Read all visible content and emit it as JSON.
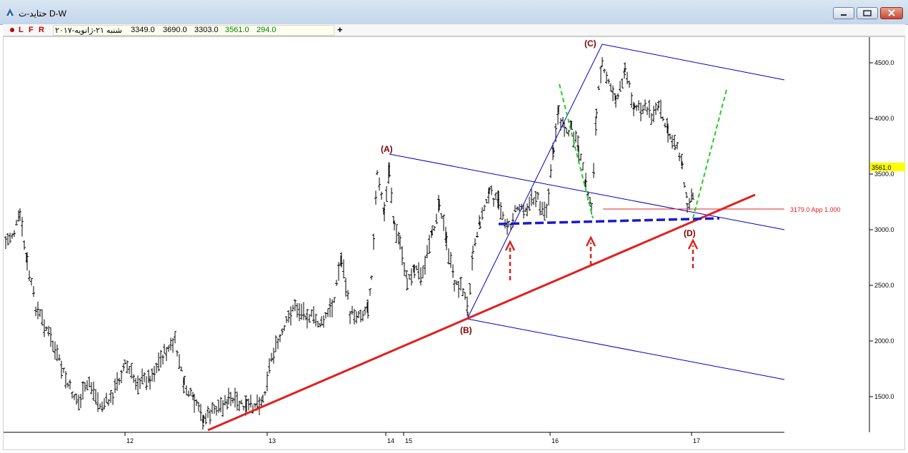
{
  "window": {
    "title": "حتاید-ت D-W",
    "buttons": [
      "minimize",
      "restore",
      "close"
    ]
  },
  "infobar": {
    "letters": [
      "L",
      "F",
      "R"
    ],
    "date": "شنبه ۲۱-ژانویه-۲۰۱۷",
    "open": "3349.0",
    "high": "3690.0",
    "low": "3303.0",
    "close": "3561.0",
    "change": "294.0",
    "add_symbol": "+"
  },
  "chart_data": {
    "type": "candlestick",
    "y_axis": {
      "ticks": [
        1500,
        2000,
        2500,
        3000,
        3500,
        4000,
        4500
      ],
      "tick_labels": [
        "1500.0",
        "2000.0",
        "2500.0",
        "3000.0",
        "3500.0",
        "4000.0",
        "4500.0"
      ]
    },
    "x_axis": {
      "ticks": [
        "12",
        "13",
        "14",
        "15",
        "16",
        "17"
      ]
    },
    "last_price": {
      "value": 3561.0,
      "label": "3561.0",
      "color": "#ffff00"
    },
    "price_line": {
      "value": 3179.0,
      "label": "3179.0 App 1.000",
      "color": "#e02020"
    },
    "wave_labels": [
      {
        "label": "(A)",
        "value": 3680
      },
      {
        "label": "(B)",
        "value": 2210
      },
      {
        "label": "(C)",
        "value": 4650
      },
      {
        "label": "(D)",
        "value": 3070
      }
    ],
    "colors": {
      "bars": "#000000",
      "channel": "#0000cc",
      "trendline": "#e02020",
      "support": "#1a1acc",
      "projection": "#22cc22",
      "arrows": "#e02020"
    }
  }
}
